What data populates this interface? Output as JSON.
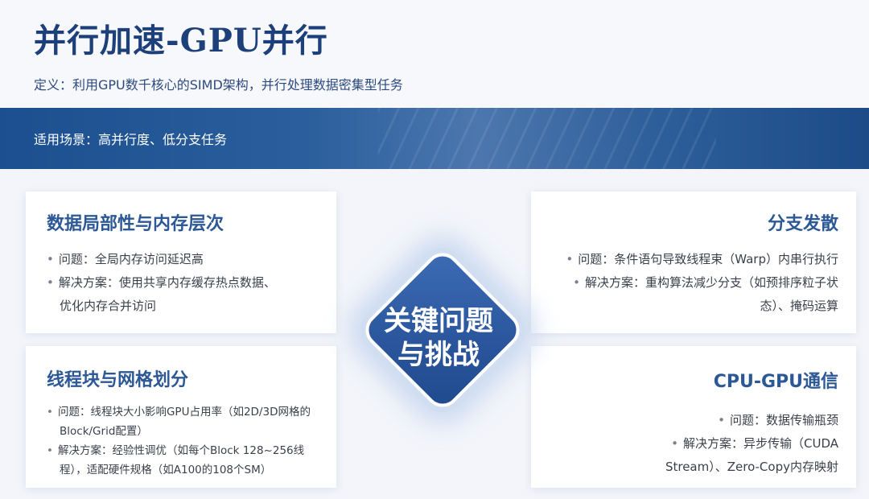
{
  "header": {
    "title": "并行加速-GPU并行",
    "definition": "定义：利用GPU数千核心的SIMD架构，并行处理数据密集型任务"
  },
  "banner": {
    "scenario": "适用场景：高并行度、低分支任务"
  },
  "center": {
    "line1": "关键问题",
    "line2": "与挑战"
  },
  "cards": {
    "memory": {
      "title": "数据局部性与内存层次",
      "items": [
        "问题：全局内存访问延迟高",
        "解决方案：使用共享内存缓存热点数据、",
        "优化内存合并访问"
      ]
    },
    "branch": {
      "title": "分支发散",
      "items": [
        "问题：条件语句导致线程束（Warp）内串行执行",
        "解决方案：重构算法减少分支（如预排序粒子状",
        "态）、掩码运算"
      ]
    },
    "grid": {
      "title": "线程块与网格划分",
      "items": [
        "问题：线程块大小影响GPU占用率（如2D/3D网格的",
        "Block/Grid配置）",
        "解决方案：经验性调优（如每个Block 128~256线",
        "程），适配硬件规格（如A100的108个SM）"
      ]
    },
    "comm": {
      "title": "CPU-GPU通信",
      "items": [
        "问题：数据传输瓶颈",
        "解决方案：异步传输（CUDA",
        "Stream）、Zero-Copy内存映射"
      ]
    }
  },
  "colors": {
    "title": "#1d3f7a",
    "banner": "#1b4f8f",
    "card_title": "#2c5896",
    "diamond": "#2a559c"
  }
}
